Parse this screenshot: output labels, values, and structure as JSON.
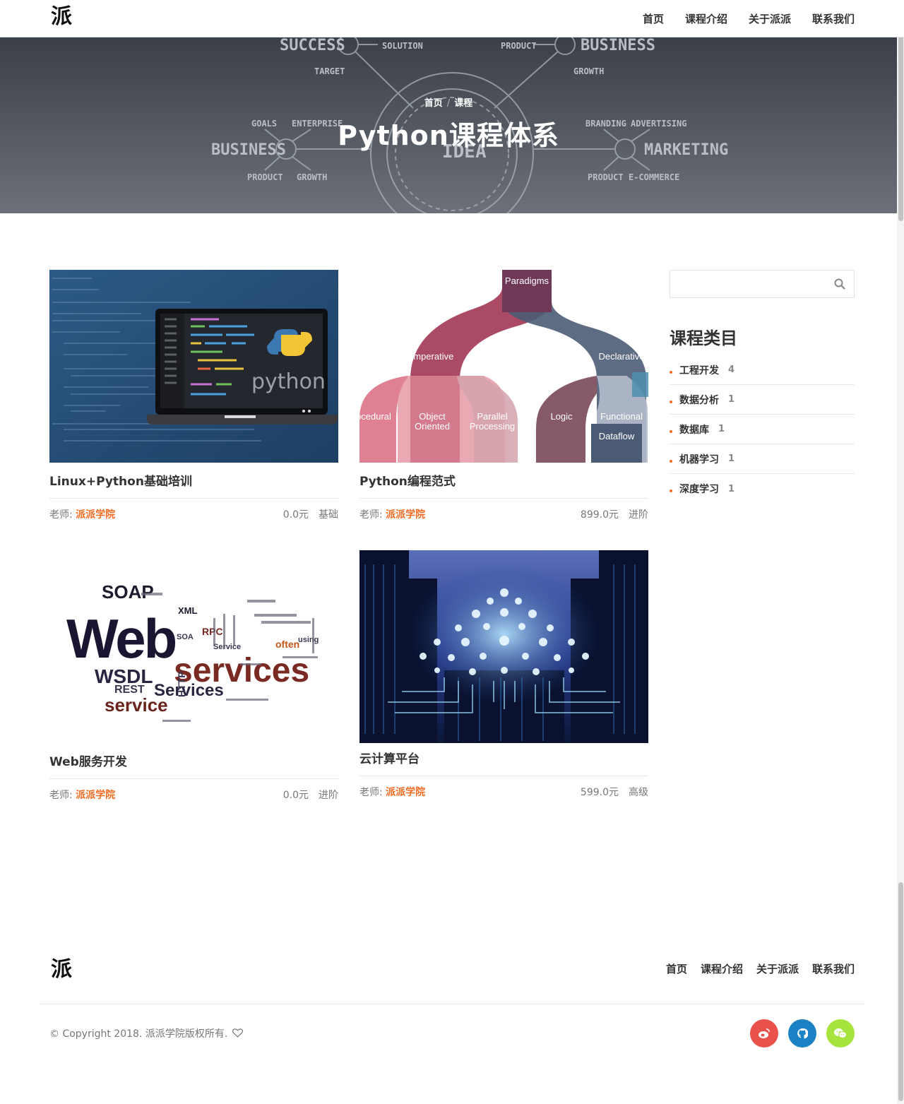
{
  "header": {
    "logo": "派",
    "nav": [
      "首页",
      "课程介绍",
      "关于派派",
      "联系我们"
    ]
  },
  "hero": {
    "breadcrumb": [
      "首页",
      "课程"
    ],
    "title": "Python课程体系",
    "background_words": [
      "SUCCESS",
      "SOLUTION",
      "PRODUCT",
      "BUSINESS",
      "TARGET",
      "GROWTH",
      "GOALS",
      "ENTERPRISE",
      "BUSINESS",
      "BRANDING",
      "ADVERTISING",
      "MARKETING",
      "PRODUCT",
      "GROWTH",
      "PRODUCT",
      "E-COMMERCE",
      "IDEA"
    ]
  },
  "courses": [
    {
      "title": "Linux+Python基础培训",
      "teacher_label": "老师:",
      "teacher": "派派学院",
      "price": "0.0元",
      "level": "基础",
      "image": "python-laptop"
    },
    {
      "title": "Python编程范式",
      "teacher_label": "老师:",
      "teacher": "派派学院",
      "price": "899.0元",
      "level": "进阶",
      "image": "paradigms-diagram"
    },
    {
      "title": "Web服务开发",
      "teacher_label": "老师:",
      "teacher": "派派学院",
      "price": "0.0元",
      "level": "进阶",
      "image": "web-services-wordcloud"
    },
    {
      "title": "云计算平台",
      "teacher_label": "老师:",
      "teacher": "派派学院",
      "price": "599.0元",
      "level": "高级",
      "image": "cloud-datacenter"
    }
  ],
  "paradigm_labels": [
    "Paradigms",
    "Imperative",
    "Declarative",
    "ocedural",
    "Object",
    "Oriented",
    "Parallel",
    "Processing",
    "Logic",
    "Functional",
    "Dataflow"
  ],
  "laptop_logo": "python",
  "wordcloud": [
    "SOAP",
    "XML",
    "Web",
    "WSDL",
    "services",
    "REST",
    "Services",
    "service",
    "RPC",
    "SOA",
    "often",
    "using",
    "HTTP",
    "Service"
  ],
  "sidebar": {
    "search": {
      "placeholder": "",
      "icon": "search-icon"
    },
    "title": "课程类目",
    "categories": [
      {
        "name": "工程开发",
        "count": "4"
      },
      {
        "name": "数据分析",
        "count": "1"
      },
      {
        "name": "数据库",
        "count": "1"
      },
      {
        "name": "机器学习",
        "count": "1"
      },
      {
        "name": "深度学习",
        "count": "1"
      }
    ]
  },
  "footer": {
    "logo": "派",
    "nav": [
      "首页",
      "课程介绍",
      "关于派派",
      "联系我们"
    ],
    "copyright": "© Copyright 2018. 派派学院版权所有.",
    "social": [
      {
        "name": "weibo",
        "color": "#e9524a"
      },
      {
        "name": "github",
        "color": "#1a82c4"
      },
      {
        "name": "wechat",
        "color": "#a7e33d"
      }
    ]
  },
  "colors": {
    "accent": "#f26b22",
    "hero_bg": "#4b4f57",
    "text": "#333333"
  }
}
